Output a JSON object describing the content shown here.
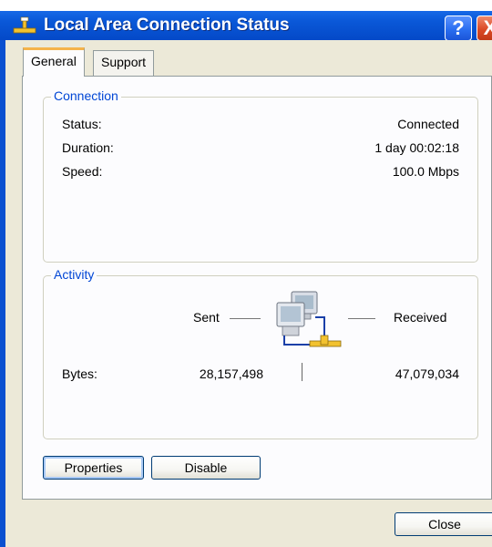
{
  "window": {
    "title": "Local Area Connection Status",
    "help_label": "?",
    "close_label": "X"
  },
  "tabs": [
    {
      "label": "General",
      "active": true
    },
    {
      "label": "Support",
      "active": false
    }
  ],
  "connection": {
    "group_title": "Connection",
    "rows": [
      {
        "label": "Status:",
        "value": "Connected"
      },
      {
        "label": "Duration:",
        "value": "1 day 00:02:18"
      },
      {
        "label": "Speed:",
        "value": "100.0 Mbps"
      }
    ]
  },
  "activity": {
    "group_title": "Activity",
    "sent_label": "Sent",
    "received_label": "Received",
    "bytes_label": "Bytes:",
    "bytes_sent": "28,157,498",
    "bytes_received": "47,079,034"
  },
  "buttons": {
    "properties": "Properties",
    "disable": "Disable",
    "close": "Close"
  },
  "colors": {
    "titlebar": "#0449c8",
    "dialog_face": "#ece9d8",
    "group_title": "#0046d5",
    "active_tab_accent": "#f5b34a"
  },
  "icons": {
    "title": "network-connection-icon",
    "activity": "two-computers-network-icon"
  }
}
